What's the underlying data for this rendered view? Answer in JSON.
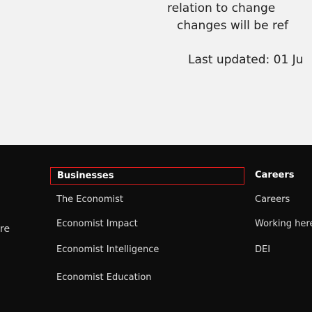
{
  "notice": {
    "line1": "relation to change",
    "line2": "changes will be ref",
    "updated": "Last updated: 01 Ju"
  },
  "footer": {
    "edge_text": "re",
    "businesses": {
      "heading": "Businesses",
      "links": [
        "The Economist",
        "Economist Impact",
        "Economist Intelligence",
        "Economist Education"
      ]
    },
    "careers": {
      "heading": "Careers",
      "links": [
        "Careers",
        "Working here",
        "DEI"
      ]
    }
  },
  "colors": {
    "footer_bg": "#0d0d0d",
    "notice_bg": "#f2f2f2",
    "focus_outline": "#e21c1c"
  }
}
